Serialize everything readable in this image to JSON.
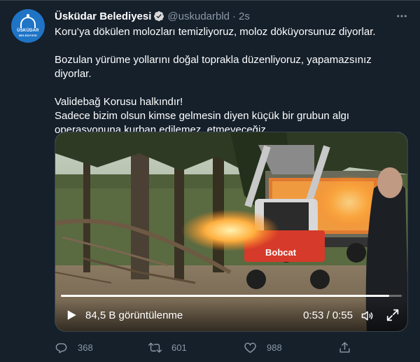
{
  "account": {
    "display_name": "Üsküdar Belediyesi",
    "handle": "@uskudarbld",
    "separator": "·",
    "time": "2s",
    "avatar_text_line1": "ÜSKÜDAR",
    "avatar_text_line2": "BELEDİYESİ"
  },
  "tweet": {
    "line1": "Koru’ya dökülen molozları temizliyoruz, moloz döküyorsunuz diyorlar.",
    "line2": "Bozulan yürüme yollarını doğal toprakla düzenliyoruz, yapamazsınız diyorlar.",
    "line3": "Validebağ Korusu halkındır!",
    "line4": "Sadece bizim olsun kimse gelmesin diyen küçük bir grubun algı operasyonuna kurban edilemez, etmeyeceğiz."
  },
  "video": {
    "views_text": "84,5 B görüntülenme",
    "timecode": "0:53 / 0:55",
    "progress_fraction": 0.964,
    "brand_on_vehicle": "Bobcat"
  },
  "actions": {
    "reply_count": "368",
    "retweet_count": "601",
    "like_count": "988"
  },
  "colors": {
    "background": "#15202b",
    "text": "#ffffff",
    "secondary_text": "#8b98a5",
    "verified": "#1d9bf0",
    "avatar": "#1f74c6"
  },
  "icons": {
    "verified": "verified-badge-icon",
    "more": "more-dots-icon",
    "play": "play-icon",
    "volume": "volume-icon",
    "fullscreen": "fullscreen-icon",
    "reply": "reply-icon",
    "retweet": "retweet-icon",
    "like": "heart-icon",
    "share": "share-icon"
  }
}
